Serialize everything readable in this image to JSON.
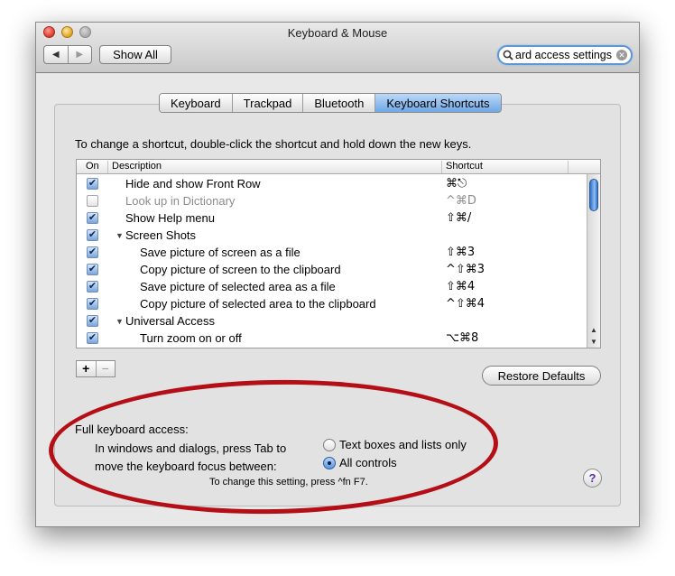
{
  "window": {
    "title": "Keyboard & Mouse"
  },
  "toolbar": {
    "back_label": "◀",
    "forward_label": "▶",
    "show_all_label": "Show All",
    "search_value": "ard access settings"
  },
  "tabs": [
    "Keyboard",
    "Trackpad",
    "Bluetooth",
    "Keyboard Shortcuts"
  ],
  "active_tab": "Keyboard Shortcuts",
  "instructions": "To change a shortcut, double-click the shortcut and hold down the new keys.",
  "table": {
    "columns": {
      "on": "On",
      "description": "Description",
      "shortcut": "Shortcut"
    },
    "rows": [
      {
        "checked": true,
        "description": "Hide and show Front Row",
        "shortcut": "⌘⎋",
        "type": "item",
        "level": 0,
        "dim": false
      },
      {
        "checked": false,
        "description": "Look up in Dictionary",
        "shortcut": "^⌘D",
        "type": "item",
        "level": 0,
        "dim": true
      },
      {
        "checked": true,
        "description": "Show Help menu",
        "shortcut": "⇧⌘/",
        "type": "item",
        "level": 0,
        "dim": false
      },
      {
        "checked": true,
        "description": "Screen Shots",
        "shortcut": "",
        "type": "group",
        "level": 0,
        "dim": false
      },
      {
        "checked": true,
        "description": "Save picture of screen as a file",
        "shortcut": "⇧⌘3",
        "type": "item",
        "level": 1,
        "dim": false
      },
      {
        "checked": true,
        "description": "Copy picture of screen to the clipboard",
        "shortcut": "^⇧⌘3",
        "type": "item",
        "level": 1,
        "dim": false
      },
      {
        "checked": true,
        "description": "Save picture of selected area as a file",
        "shortcut": "⇧⌘4",
        "type": "item",
        "level": 1,
        "dim": false
      },
      {
        "checked": true,
        "description": "Copy picture of selected area to the clipboard",
        "shortcut": "^⇧⌘4",
        "type": "item",
        "level": 1,
        "dim": false
      },
      {
        "checked": true,
        "description": "Universal Access",
        "shortcut": "",
        "type": "group",
        "level": 0,
        "dim": false
      },
      {
        "checked": true,
        "description": "Turn zoom on or off",
        "shortcut": "⌥⌘8",
        "type": "item",
        "level": 1,
        "dim": false
      }
    ]
  },
  "buttons": {
    "add": "+",
    "remove": "−",
    "restore_defaults": "Restore Defaults",
    "help": "?"
  },
  "full_keyboard_access": {
    "title": "Full keyboard access:",
    "explain_line1": "In windows and dialogs, press Tab to",
    "explain_line2": "move the keyboard focus between:",
    "option1": "Text boxes and lists only",
    "option2": "All controls",
    "selected": "All controls",
    "hint": "To change this setting, press ^fn F7."
  },
  "colors": {
    "annotation": "#b40e16",
    "accent": "#6fa7e6"
  }
}
